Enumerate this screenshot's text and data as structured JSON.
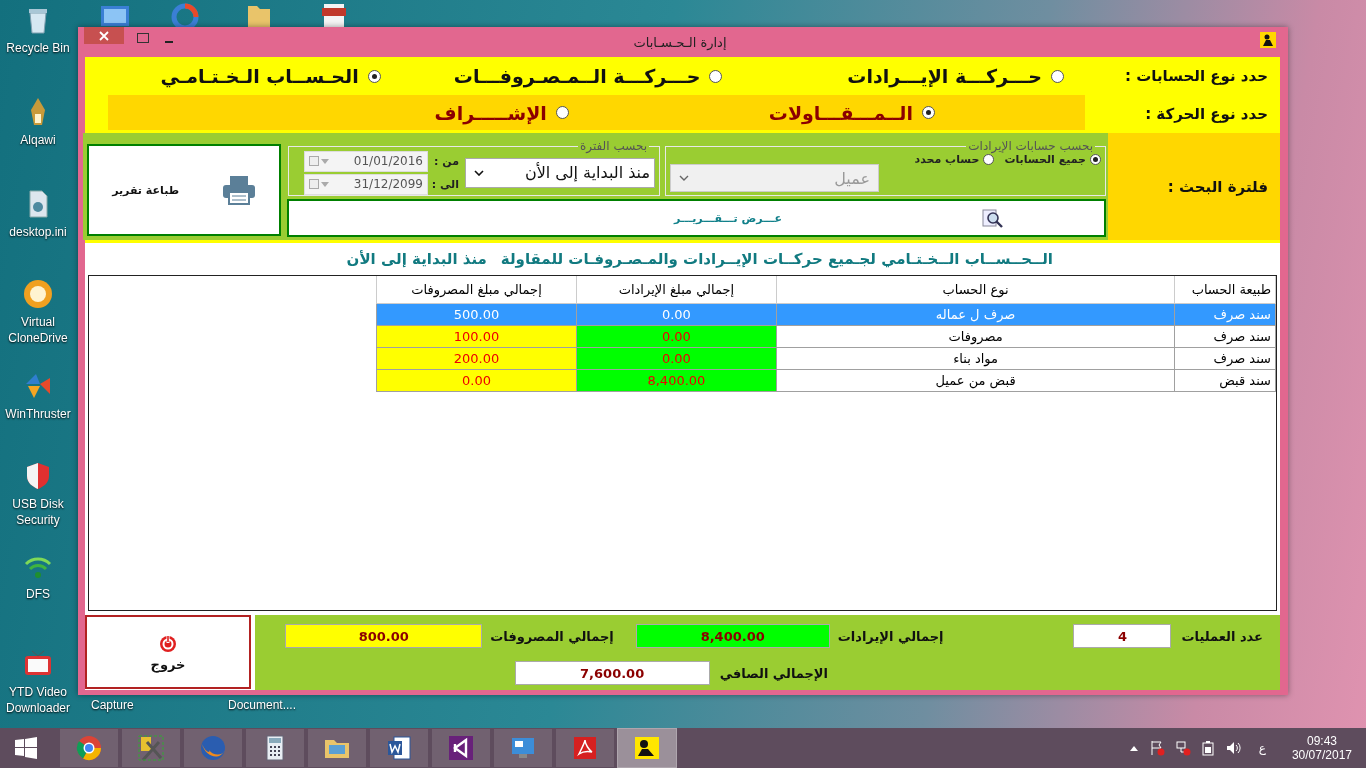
{
  "desktop": {
    "icons": [
      {
        "label": "Recycle Bin"
      },
      {
        "label": "Alqawi"
      },
      {
        "label": "desktop.ini"
      },
      {
        "label": "Virtual CloneDrive"
      },
      {
        "label": "WinThruster"
      },
      {
        "label": "USB Disk Security"
      },
      {
        "label": "DFS"
      },
      {
        "label": "YTD Video Downloader"
      }
    ],
    "hidden_icon_labels": [
      "Document....",
      "Capture"
    ]
  },
  "window": {
    "title": "إدارة الـحـسـابات"
  },
  "account_type": {
    "label": "حدد نوع الحسابات :",
    "options": [
      {
        "label": "حـــركـــة الإيـــرادات",
        "selected": false
      },
      {
        "label": "حـــركـــة الــمـصـروفـــات",
        "selected": false
      },
      {
        "label": "الحـســاب الـخـتـامـي",
        "selected": true
      }
    ]
  },
  "movement_type": {
    "label": "حدد نوع الحركة :",
    "options": [
      {
        "label": "الــمـــقـــاولات",
        "selected": true
      },
      {
        "label": "الإشـــــراف",
        "selected": false
      }
    ]
  },
  "filter": {
    "label": "فلترة البحث :",
    "print_button": "طباعة تقرير",
    "period": {
      "title": "بحسب الفترة",
      "from_label": "من :",
      "from": "01/01/2016",
      "to_label": "الى :",
      "to": "31/12/2099",
      "range": "منذ البداية إلى الأن"
    },
    "accounts": {
      "title": "بحسب حسابات الإيرادات",
      "options": [
        {
          "label": "جميع الحسابات",
          "selected": true
        },
        {
          "label": "حساب محدد",
          "selected": false
        }
      ],
      "account": {
        "value": "عميل",
        "disabled": true
      }
    },
    "show_button": "عـــرض تـــقـــريـــر"
  },
  "report": {
    "title": "الــحــســاب الــخـتـامي  لجـميع حركــات الإيــرادات والمـصـروفـات للمقاولة",
    "period": "منذ البداية إلى الأن"
  },
  "table": {
    "columns": [
      "طبيعة الحساب",
      "نوع الحساب",
      "إجمالي مبلغ الإيرادات",
      "إجمالي مبلغ المصروفات"
    ],
    "rows": [
      {
        "cells": [
          "سند صرف",
          "صرف ل عماله",
          "0.00",
          "500.00"
        ],
        "selected": true
      },
      {
        "cells": [
          "سند صرف",
          "مصروفات",
          "0.00",
          "100.00"
        ],
        "selected": false
      },
      {
        "cells": [
          "سند صرف",
          "مواد بناء",
          "0.00",
          "200.00"
        ],
        "selected": false
      },
      {
        "cells": [
          "سند قبض",
          "قبض من عميل",
          "8,400.00",
          "0.00"
        ],
        "selected": false
      }
    ]
  },
  "totals": {
    "count_label": "عدد العمليات",
    "count": "4",
    "revenue_label": "إجمالي الإيرادات",
    "revenue": "8,400.00",
    "expense_label": "إجمالي المصروفات",
    "expense": "800.00",
    "net_label": "الإجمالي الصافي",
    "net": "7,600.00"
  },
  "exit_button": "خروج",
  "taskbar": {
    "apps": [
      {
        "kind": "globe",
        "selected": false
      },
      {
        "kind": "tools",
        "selected": false
      },
      {
        "kind": "fox",
        "selected": false
      },
      {
        "kind": "calculator",
        "selected": false
      },
      {
        "kind": "folder",
        "selected": false
      },
      {
        "kind": "word",
        "selected": false
      },
      {
        "kind": "studio",
        "selected": false
      },
      {
        "kind": "panel",
        "selected": false
      },
      {
        "kind": "pdf",
        "selected": false
      },
      {
        "kind": "app",
        "selected": true
      }
    ]
  },
  "tray": {
    "language": "ع",
    "time": "09:43",
    "date": "30/07/2017"
  }
}
